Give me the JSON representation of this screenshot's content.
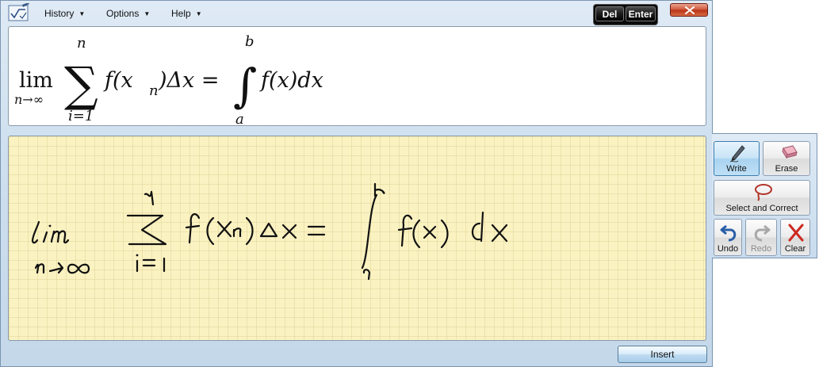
{
  "menubar": {
    "history_label": "History",
    "options_label": "Options",
    "help_label": "Help",
    "del_label": "Del",
    "enter_label": "Enter"
  },
  "preview": {
    "lim_text": "lim",
    "lim_subscript": "n→∞",
    "sum_upper": "n",
    "sum_lower": "i=1",
    "summand": "f(x",
    "summand_sub": "n",
    "summand_rest": ")Δx =",
    "integral_upper": "b",
    "integral_lower": "a",
    "integrand": "f(x)dx"
  },
  "tools": {
    "write_label": "Write",
    "erase_label": "Erase",
    "select_correct_label": "Select and Correct",
    "undo_label": "Undo",
    "redo_label": "Redo",
    "clear_label": "Clear"
  },
  "footer": {
    "insert_label": "Insert"
  },
  "icons": {
    "app": "math-input-icon",
    "close": "close-icon",
    "write": "pen-icon",
    "erase": "eraser-icon",
    "select": "lasso-icon",
    "undo": "undo-icon",
    "redo": "redo-icon",
    "clear": "clear-x-icon"
  },
  "colors": {
    "pad_background": "#fbf2c2",
    "close_red": "#c8452a",
    "active_tool": "#a9d3f0"
  }
}
